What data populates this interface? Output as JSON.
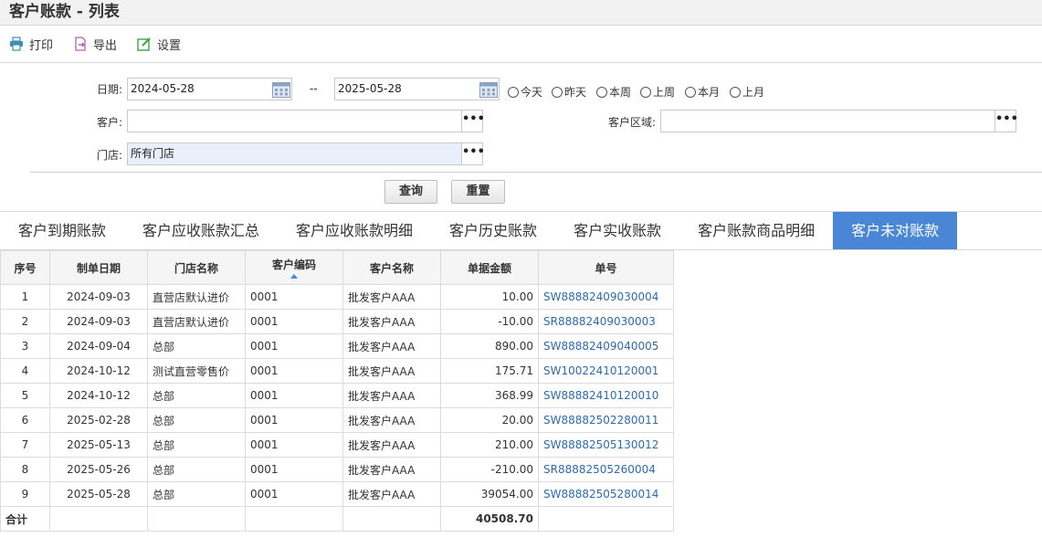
{
  "page": {
    "title": "客户账款 - 列表"
  },
  "toolbar": {
    "print_label": "打印",
    "export_label": "导出",
    "settings_label": "设置"
  },
  "filters": {
    "date_label": "日期:",
    "date_from": "2024-05-28",
    "date_sep": "--",
    "date_to": "2025-05-28",
    "quick_ranges": [
      "今天",
      "昨天",
      "本周",
      "上周",
      "本月",
      "上月"
    ],
    "customer_label": "客户:",
    "customer_value": "",
    "region_label": "客户区域:",
    "region_value": "",
    "store_label": "门店:",
    "store_value": "所有门店",
    "picker_glyph": "•••",
    "query_label": "查询",
    "reset_label": "重置"
  },
  "tabs": {
    "items": [
      "客户到期账款",
      "客户应收账款汇总",
      "客户应收账款明细",
      "客户历史账款",
      "客户实收账款",
      "客户账款商品明细",
      "客户未对账款"
    ],
    "active_index": 6,
    "active_color": "#4a86d6"
  },
  "table": {
    "columns": [
      "序号",
      "制单日期",
      "门店名称",
      "客户编码",
      "客户名称",
      "单据金额",
      "单号"
    ],
    "sorted_column": "客户编码",
    "rows": [
      [
        "1",
        "2024-09-03",
        "直营店默认进价",
        "0001",
        "批发客户AAA",
        "10.00",
        "SW88882409030004"
      ],
      [
        "2",
        "2024-09-03",
        "直营店默认进价",
        "0001",
        "批发客户AAA",
        "-10.00",
        "SR88882409030003"
      ],
      [
        "3",
        "2024-09-04",
        "总部",
        "0001",
        "批发客户AAA",
        "890.00",
        "SW88882409040005"
      ],
      [
        "4",
        "2024-10-12",
        "测试直营零售价",
        "0001",
        "批发客户AAA",
        "175.71",
        "SW10022410120001"
      ],
      [
        "5",
        "2024-10-12",
        "总部",
        "0001",
        "批发客户AAA",
        "368.99",
        "SW88882410120010"
      ],
      [
        "6",
        "2025-02-28",
        "总部",
        "0001",
        "批发客户AAA",
        "20.00",
        "SW88882502280011"
      ],
      [
        "7",
        "2025-05-13",
        "总部",
        "0001",
        "批发客户AAA",
        "210.00",
        "SW88882505130012"
      ],
      [
        "8",
        "2025-05-26",
        "总部",
        "0001",
        "批发客户AAA",
        "-210.00",
        "SR88882505260004"
      ],
      [
        "9",
        "2025-05-28",
        "总部",
        "0001",
        "批发客户AAA",
        "39054.00",
        "SW88882505280014"
      ]
    ],
    "total_label": "合计",
    "total_amount": "40508.70",
    "link_color": "#2b6cb0"
  }
}
